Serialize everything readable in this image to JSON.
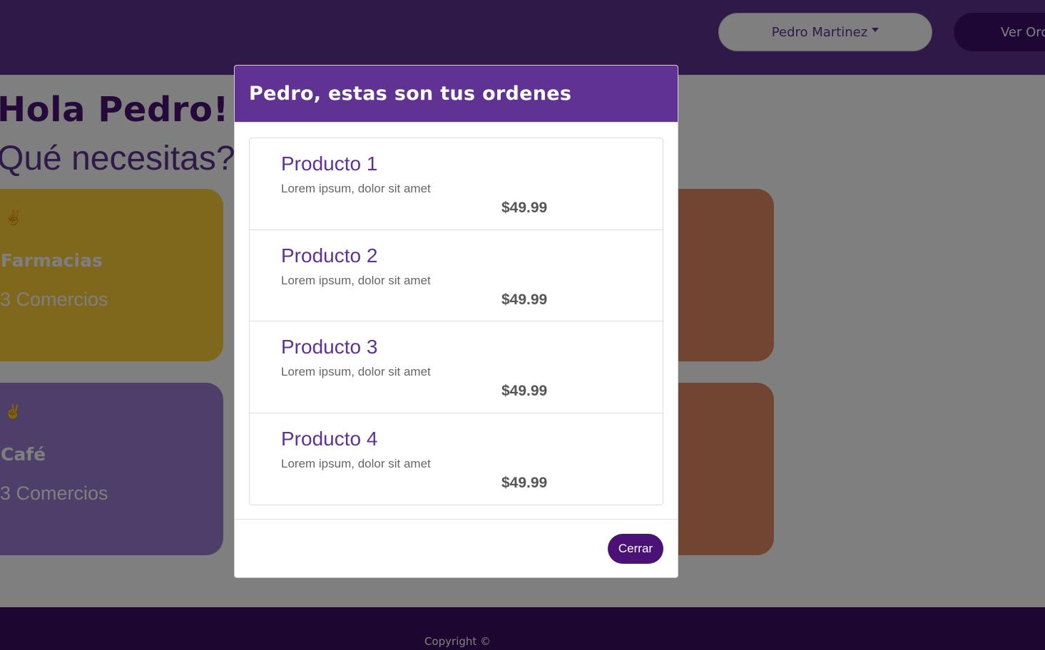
{
  "navbar": {
    "user_name": "Pedro Martinez",
    "orders_label": "Ver Ordenes"
  },
  "main": {
    "greeting": "Hola Pedro!",
    "question": "Qué necesitas?",
    "categories": [
      {
        "icon": "✌",
        "title": "Farmacias",
        "count": "3 Comercios",
        "color": "#ffce38"
      },
      {
        "icon": "✌",
        "title": "Café",
        "count": "3 Comercios",
        "color": "#9a7fd4"
      }
    ]
  },
  "footer": {
    "copyright": "Copyright ©"
  },
  "modal": {
    "title": "Pedro, estas son tus ordenes",
    "items": [
      {
        "name": "Producto 1",
        "description": "Lorem ipsum, dolor sit amet",
        "price": "$49.99"
      },
      {
        "name": "Producto 2",
        "description": "Lorem ipsum, dolor sit amet",
        "price": "$49.99"
      },
      {
        "name": "Producto 3",
        "description": "Lorem ipsum, dolor sit amet",
        "price": "$49.99"
      },
      {
        "name": "Producto 4",
        "description": "Lorem ipsum, dolor sit amet",
        "price": "$49.99"
      }
    ],
    "close_label": "Cerrar"
  },
  "colors": {
    "primary": "#5f3293",
    "primary_dark": "#4a1276",
    "card_yellow": "#ffce38",
    "card_purple": "#9a7fd4",
    "card_brown": "#e48b66"
  }
}
